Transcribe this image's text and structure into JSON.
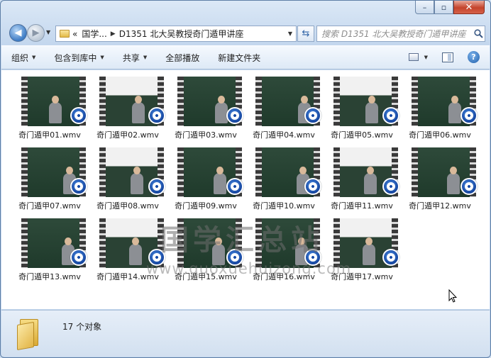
{
  "window": {
    "caption_min": "–",
    "caption_max": "▫",
    "caption_close": "✕"
  },
  "nav": {
    "back_glyph": "◀",
    "forward_glyph": "▶",
    "breadcrumb_prefix": "«",
    "breadcrumb": [
      "国学...",
      "D1351 北大吴教授奇门遁甲讲座"
    ],
    "search_placeholder": "搜索 D1351 北大吴教授奇门遁甲讲座"
  },
  "toolbar": {
    "organize": "组织",
    "include_library": "包含到库中",
    "share": "共享",
    "play_all": "全部播放",
    "new_folder": "新建文件夹",
    "help": "?"
  },
  "files": [
    "奇门遁甲01.wmv",
    "奇门遁甲02.wmv",
    "奇门遁甲03.wmv",
    "奇门遁甲04.wmv",
    "奇门遁甲05.wmv",
    "奇门遁甲06.wmv",
    "奇门遁甲07.wmv",
    "奇门遁甲08.wmv",
    "奇门遁甲09.wmv",
    "奇门遁甲10.wmv",
    "奇门遁甲11.wmv",
    "奇门遁甲12.wmv",
    "奇门遁甲13.wmv",
    "奇门遁甲14.wmv",
    "奇门遁甲15.wmv",
    "奇门遁甲16.wmv",
    "奇门遁甲17.wmv"
  ],
  "watermark": {
    "main": "国学汇总站",
    "sub": "www.guoxuehuizong.com"
  },
  "status": {
    "count_text": "17 个对象"
  },
  "colors": {
    "accent": "#1f5fab",
    "badge": "#103f99",
    "folder": "#e2b446"
  }
}
